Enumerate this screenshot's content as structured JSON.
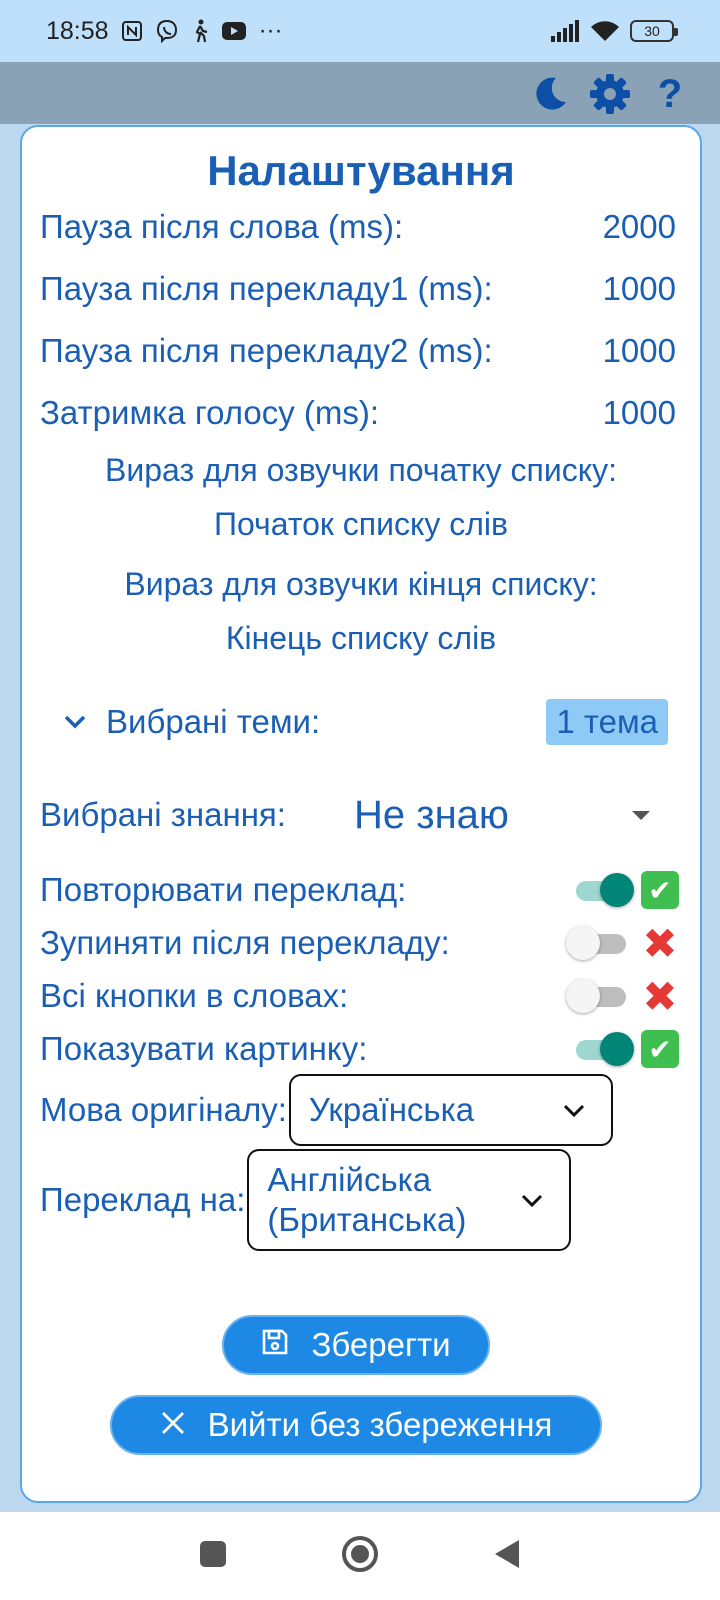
{
  "status_bar": {
    "time": "18:58",
    "more": "···",
    "battery": "30",
    "icons": [
      "nfc-icon",
      "viber-icon",
      "walking-icon",
      "youtube-icon",
      "signal-icon",
      "wifi-icon",
      "battery-icon"
    ]
  },
  "app_bar": {
    "icons": [
      "moon-icon",
      "gear-icon",
      "help-icon"
    ],
    "help_glyph": "?",
    "icon_color": "#0d4fa6"
  },
  "dialog": {
    "title": "Налаштування",
    "pause_rows": [
      {
        "label": "Пауза після слова (ms):",
        "value": "2000"
      },
      {
        "label": "Пауза після перекладу1 (ms):",
        "value": "1000"
      },
      {
        "label": "Пауза після перекладу2 (ms):",
        "value": "1000"
      },
      {
        "label": "Затримка голосу (ms):",
        "value": "1000"
      }
    ],
    "start_phrase_label": "Вираз для озвучки початку списку:",
    "start_phrase_value": "Початок списку слів",
    "end_phrase_label": "Вираз для озвучки кінця списку:",
    "end_phrase_value": "Кінець списку слів",
    "topics_label": "Вибрані теми:",
    "topics_value": "1 тема",
    "knowledge_label": "Вибрані знання:",
    "knowledge_value": "Не знаю",
    "toggles": [
      {
        "label": "Повторювати переклад:",
        "on": true,
        "mark": "✔"
      },
      {
        "label": "Зупиняти після перекладу:",
        "on": false,
        "mark": "✖"
      },
      {
        "label": "Всі кнопки в словах:",
        "on": false,
        "mark": "✖"
      },
      {
        "label": "Показувати картинку:",
        "on": true,
        "mark": "✔"
      }
    ],
    "source_lang_label": "Мова оригіналу:",
    "source_lang_value": "Українська",
    "target_lang_label": "Переклад на:",
    "target_lang_value_line1": "Англійська",
    "target_lang_value_line2": "(Британська)",
    "save_label": "Зберегти",
    "exit_label": "Вийти без збереження"
  },
  "colors": {
    "accent": "#1b5fb5",
    "button": "#1e88e5",
    "toggle_on": "#008577",
    "check": "#3fbf4f",
    "cross": "#e53935"
  }
}
